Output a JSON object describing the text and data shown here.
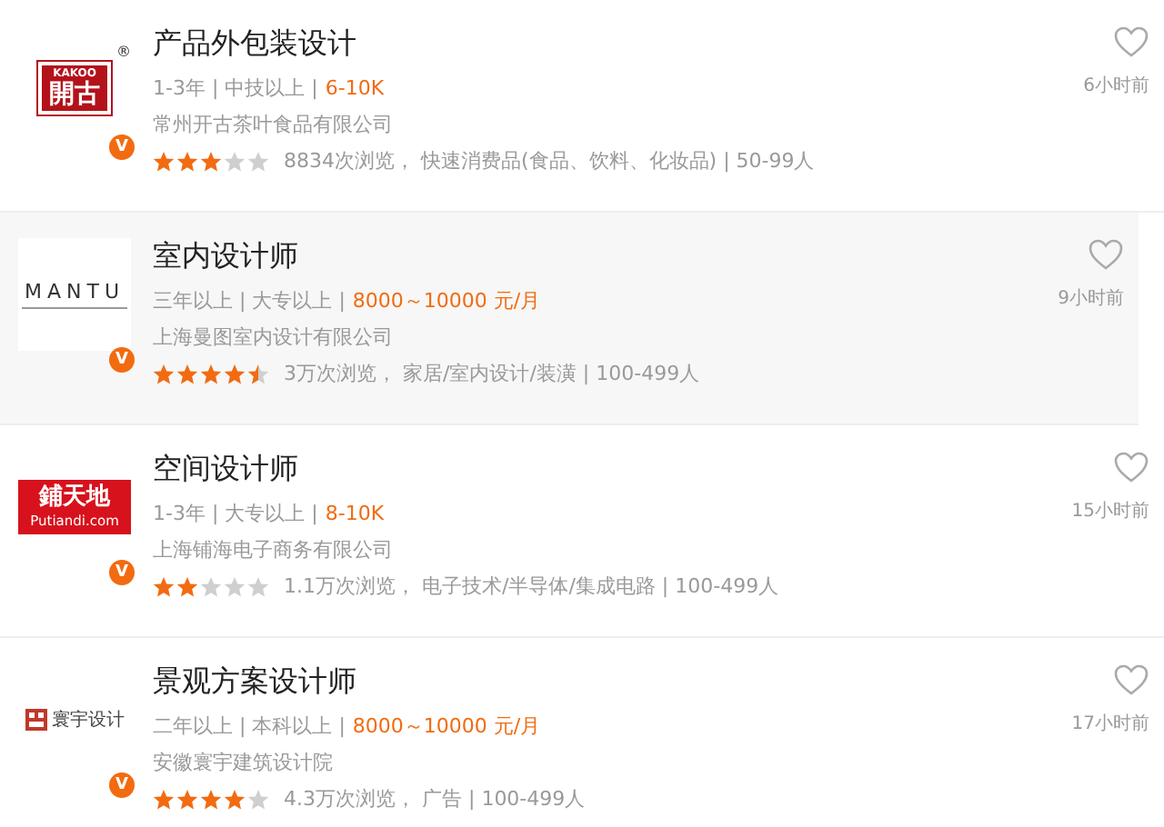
{
  "jobs": [
    {
      "title": "产品外包装设计",
      "meta": "1-3年 | 中技以上 |",
      "salary": "6-10K",
      "company": "常州开古茶叶食品有限公司",
      "stars": 3,
      "stats": "8834次浏览，  快速消费品(食品、饮料、化妆品) | 50-99人",
      "badge": "V",
      "time": "6小时前",
      "highlighted": false,
      "logo": {
        "kind": "kakoo",
        "texts": [
          "KAKOO",
          "開古",
          "®"
        ]
      }
    },
    {
      "title": "室内设计师",
      "meta": "三年以上 | 大专以上 |",
      "salary": "8000～10000 元/月",
      "company": "上海曼图室内设计有限公司",
      "stars": 4.5,
      "stats": "3万次浏览，  家居/室内设计/装潢 | 100-499人",
      "badge": "V",
      "time": "9小时前",
      "highlighted": true,
      "logo": {
        "kind": "mantu",
        "texts": [
          "MANTU"
        ]
      }
    },
    {
      "title": "空间设计师",
      "meta": "1-3年 | 大专以上 |",
      "salary": "8-10K",
      "company": "上海铺海电子商务有限公司",
      "stars": 2,
      "stats": "1.1万次浏览，  电子技术/半导体/集成电路 | 100-499人",
      "badge": "V",
      "time": "15小时前",
      "highlighted": false,
      "logo": {
        "kind": "putiandi",
        "texts": [
          "鋪天地",
          "Putiandi.com"
        ]
      }
    },
    {
      "title": "景观方案设计师",
      "meta": "二年以上 | 本科以上 |",
      "salary": "8000～10000 元/月",
      "company": "安徽寰宇建筑设计院",
      "stars": 4,
      "stats": "4.3万次浏览，  广告 | 100-499人",
      "badge": "V",
      "time": "17小时前",
      "highlighted": false,
      "logo": {
        "kind": "huanyu",
        "texts": [
          "寰宇设计"
        ]
      }
    }
  ]
}
